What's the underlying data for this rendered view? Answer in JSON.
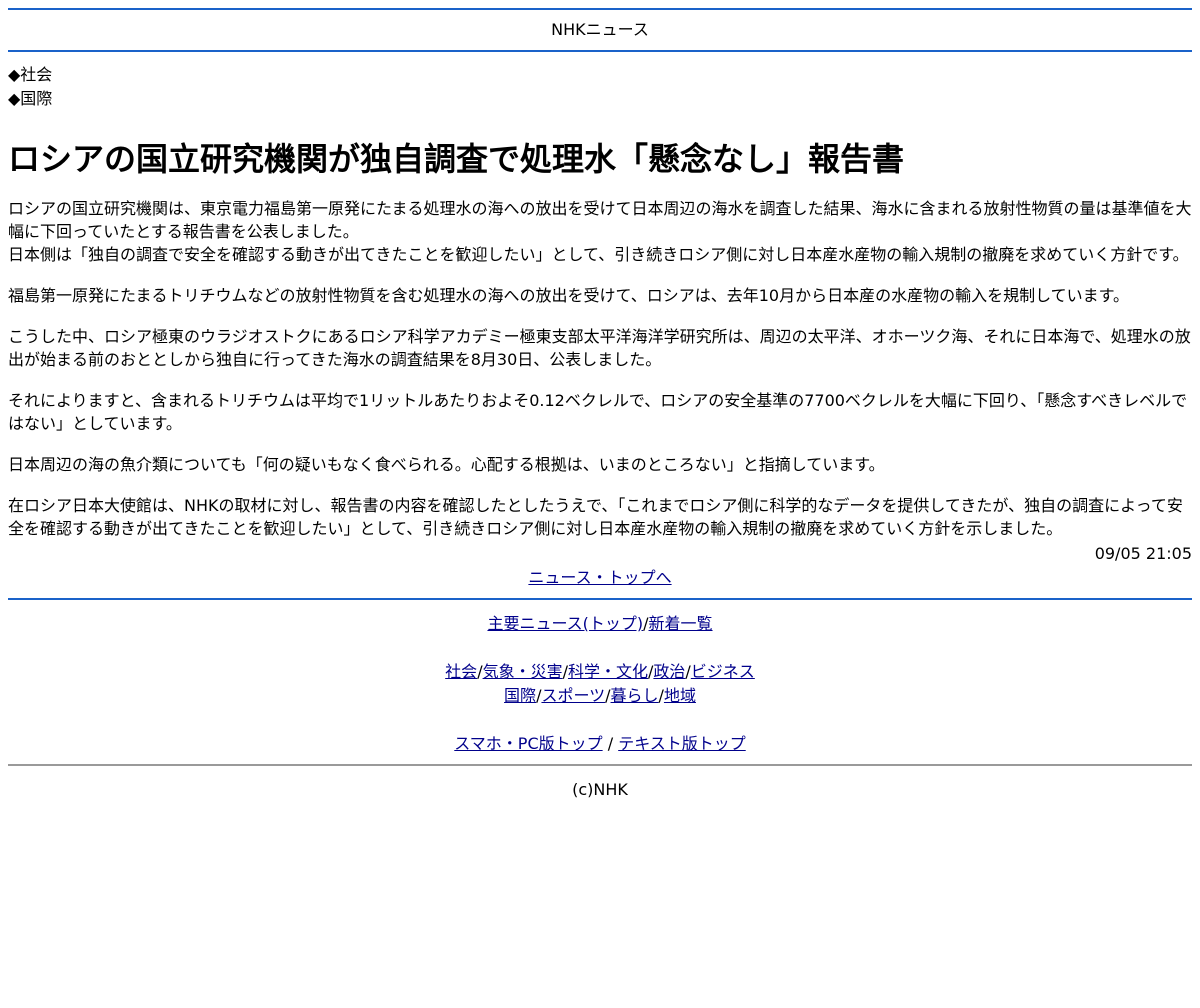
{
  "header": {
    "title": "NHKニュース"
  },
  "categories": [
    "◆社会",
    "◆国際"
  ],
  "article": {
    "headline": "ロシアの国立研究機関が独自調査で処理水「懸念なし」報告書",
    "lead_1": "ロシアの国立研究機関は、東京電力福島第一原発にたまる処理水の海への放出を受けて日本周辺の海水を調査した結果、海水に含まれる放射性物質の量は基準値を大幅に下回っていたとする報告書を公表しました。",
    "lead_2": "日本側は「独自の調査で安全を確認する動きが出てきたことを歓迎したい」として、引き続きロシア側に対し日本産水産物の輸入規制の撤廃を求めていく方針です。",
    "p2": "福島第一原発にたまるトリチウムなどの放射性物質を含む処理水の海への放出を受けて、ロシアは、去年10月から日本産の水産物の輸入を規制しています。",
    "p3": "こうした中、ロシア極東のウラジオストクにあるロシア科学アカデミー極東支部太平洋海洋学研究所は、周辺の太平洋、オホーツク海、それに日本海で、処理水の放出が始まる前のおととしから独自に行ってきた海水の調査結果を8月30日、公表しました。",
    "p4": "それによりますと、含まれるトリチウムは平均で1リットルあたりおよそ0.12ベクレルで、ロシアの安全基準の7700ベクレルを大幅に下回り、「懸念すべきレベルではない」としています。",
    "p5": "日本周辺の海の魚介類についても「何の疑いもなく食べられる。心配する根拠は、いまのところない」と指摘しています。",
    "p6": "在ロシア日本大使館は、NHKの取材に対し、報告書の内容を確認したとしたうえで、「これまでロシア側に科学的なデータを提供してきたが、独自の調査によって安全を確認する動きが出てきたことを歓迎したい」として、引き続きロシア側に対し日本産水産物の輸入規制の撤廃を求めていく方針を示しました。",
    "timestamp": "09/05 21:05"
  },
  "back_link": "ニュース・トップへ",
  "footer": {
    "main_news": "主要ニュース(トップ)",
    "latest": "新着一覧",
    "sep": "/",
    "cats_row1": [
      "社会",
      "気象・災害",
      "科学・文化",
      "政治",
      "ビジネス"
    ],
    "cats_row2": [
      "国際",
      "スポーツ",
      "暮らし",
      "地域"
    ],
    "smartphone_top": "スマホ・PC版トップ",
    "sep_spaced": " / ",
    "text_top": "テキスト版トップ",
    "copyright": "(c)NHK"
  }
}
